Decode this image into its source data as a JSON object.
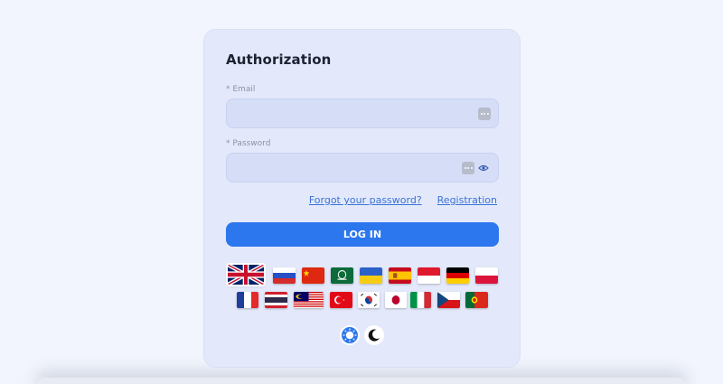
{
  "auth": {
    "title": "Authorization",
    "email_label": "Email",
    "password_label": "Password",
    "required_mark": "*",
    "email_value": "",
    "password_value": "",
    "forgot_link": "Forgot your password?",
    "register_link": "Registration",
    "login_button": "LOG IN"
  },
  "languages": [
    {
      "flag": "united-kingdom",
      "selected": true
    },
    {
      "flag": "russia"
    },
    {
      "flag": "china"
    },
    {
      "flag": "saudi-arabia"
    },
    {
      "flag": "ukraine"
    },
    {
      "flag": "spain"
    },
    {
      "flag": "indonesia"
    },
    {
      "flag": "germany"
    },
    {
      "flag": "poland"
    },
    {
      "flag": "france"
    },
    {
      "flag": "thailand"
    },
    {
      "flag": "malaysia"
    },
    {
      "flag": "turkey"
    },
    {
      "flag": "south-korea"
    },
    {
      "flag": "japan"
    },
    {
      "flag": "italy"
    },
    {
      "flag": "czech-republic"
    },
    {
      "flag": "portugal"
    }
  ],
  "theme": {
    "options": [
      "light-theme-icon",
      "dark-theme-icon"
    ],
    "selected": "light"
  },
  "colors": {
    "accent": "#2c77ee",
    "card": "#e3e9fb",
    "field": "#d6def7",
    "link": "#3a73d6"
  }
}
